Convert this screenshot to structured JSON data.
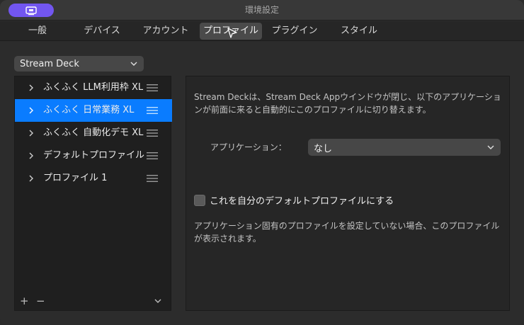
{
  "window": {
    "title": "環境設定"
  },
  "tabs": [
    {
      "label": "一般",
      "active": false
    },
    {
      "label": "デバイス",
      "active": false
    },
    {
      "label": "アカウント",
      "active": false
    },
    {
      "label": "プロファイル",
      "active": true
    },
    {
      "label": "プラグイン",
      "active": false
    },
    {
      "label": "スタイル",
      "active": false
    }
  ],
  "device_select": {
    "value": "Stream Deck"
  },
  "profiles": [
    {
      "label": "ふくふく LLM利用枠 XL",
      "selected": false
    },
    {
      "label": "ふくふく 日常業務 XL",
      "selected": true
    },
    {
      "label": "ふくふく 自動化デモ XL",
      "selected": false
    },
    {
      "label": "デフォルトプロファイル",
      "selected": false
    },
    {
      "label": "プロファイル 1",
      "selected": false
    }
  ],
  "profile_footer": {
    "add_label": "+",
    "remove_label": "−"
  },
  "detail": {
    "description": "Stream Deckは、Stream Deck Appウインドウが閉じ、以下のアプリケーションが前面に来ると自動的にこのプロファイルに切り替えます。",
    "app_label": "アプリケーション：",
    "app_value": "なし",
    "default_checkbox_label": "これを自分のデフォルトプロファイルにする",
    "default_checked": false,
    "note": "アプリケーション固有のプロファイルを設定していない場合、このプロファイルが表示されます。"
  },
  "colors": {
    "accent": "#0a7cff",
    "app_pill": "#7256f0"
  }
}
